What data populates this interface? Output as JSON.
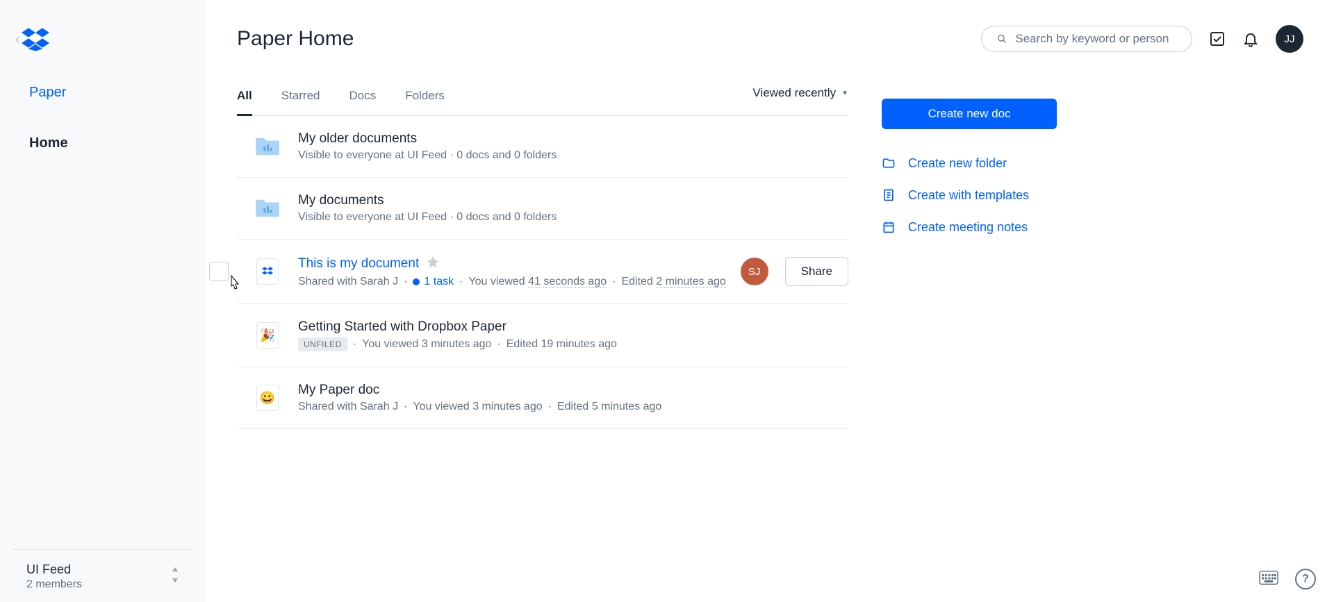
{
  "sidebar": {
    "nav": {
      "paper": "Paper",
      "home": "Home"
    },
    "org": {
      "name": "UI Feed",
      "members": "2 members"
    }
  },
  "header": {
    "title": "Paper Home",
    "search_placeholder": "Search by keyword or person",
    "avatar_initials": "JJ"
  },
  "tabs": {
    "all": "All",
    "starred": "Starred",
    "docs": "Docs",
    "folders": "Folders",
    "sort": "Viewed recently"
  },
  "rows": [
    {
      "title": "My older documents",
      "meta_full": "Visible to everyone at UI Feed · 0 docs and 0 folders"
    },
    {
      "title": "My documents",
      "meta_full": "Visible to everyone at UI Feed · 0 docs and 0 folders"
    },
    {
      "title": "This is my document",
      "shared_with": "Shared with Sarah J",
      "task": "1 task",
      "viewed": "You viewed 41 seconds ago",
      "edited": "Edited 2 minutes ago",
      "sharer_initials": "SJ",
      "share_label": "Share"
    },
    {
      "title": "Getting Started with Dropbox Paper",
      "unfiled": "UNFILED",
      "viewed": "You viewed 3 minutes ago",
      "edited": "Edited 19 minutes ago"
    },
    {
      "title": "My Paper doc",
      "shared_with": "Shared with Sarah J",
      "viewed": "You viewed 3 minutes ago",
      "edited": "Edited 5 minutes ago"
    }
  ],
  "rail": {
    "create_doc": "Create new doc",
    "create_folder": "Create new folder",
    "create_templates": "Create with templates",
    "create_meeting": "Create meeting notes"
  },
  "help_label": "?"
}
